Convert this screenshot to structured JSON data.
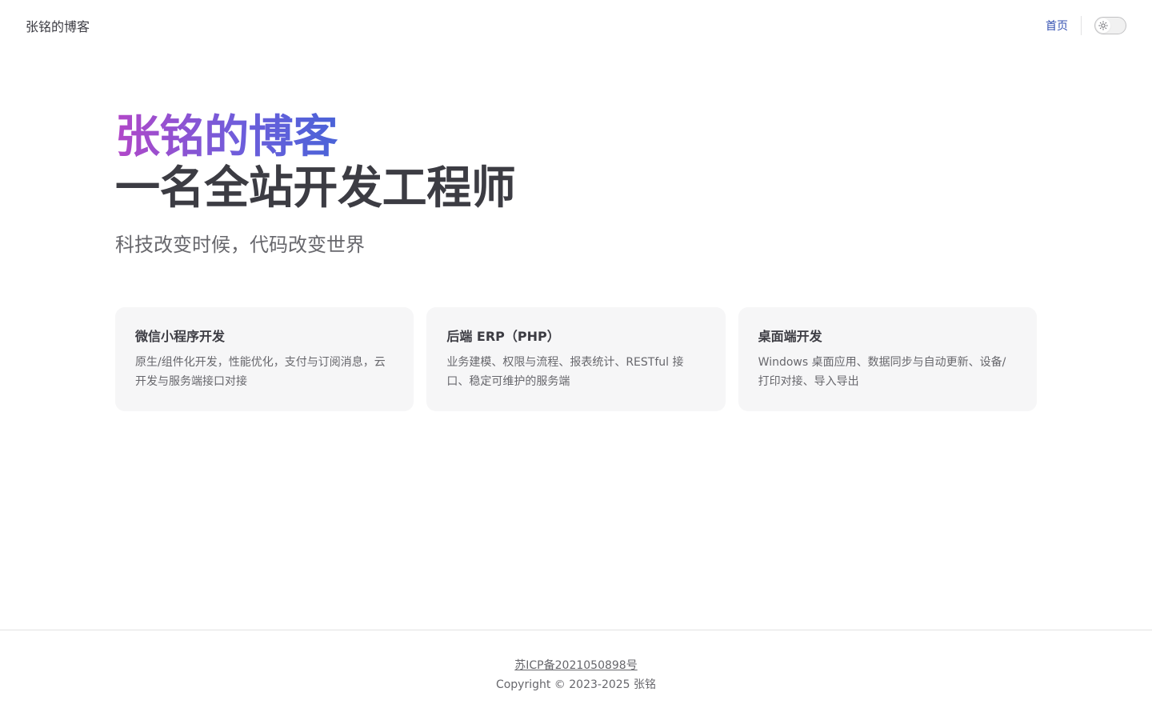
{
  "nav": {
    "site_title": "张铭的博客",
    "links": [
      {
        "label": "首页"
      }
    ],
    "theme_toggle_icon": "sun-icon"
  },
  "hero": {
    "name": "张铭的博客",
    "text": "一名全站开发工程师",
    "tagline": "科技改变时候，代码改变世界"
  },
  "features": [
    {
      "title": "微信小程序开发",
      "details": "原生/组件化开发，性能优化，支付与订阅消息，云开发与服务端接口对接"
    },
    {
      "title": "后端 ERP（PHP）",
      "details": "业务建模、权限与流程、报表统计、RESTful 接口、稳定可维护的服务端"
    },
    {
      "title": "桌面端开发",
      "details": "Windows 桌面应用、数据同步与自动更新、设备/打印对接、导入导出"
    }
  ],
  "footer": {
    "icp": "苏ICP备2021050898号",
    "copyright": "Copyright © 2023-2025 张铭"
  },
  "colors": {
    "brand": "#3451b2",
    "gradient_start": "#b247c8",
    "gradient_end": "#4a63d8",
    "card_bg": "#f6f6f7"
  }
}
